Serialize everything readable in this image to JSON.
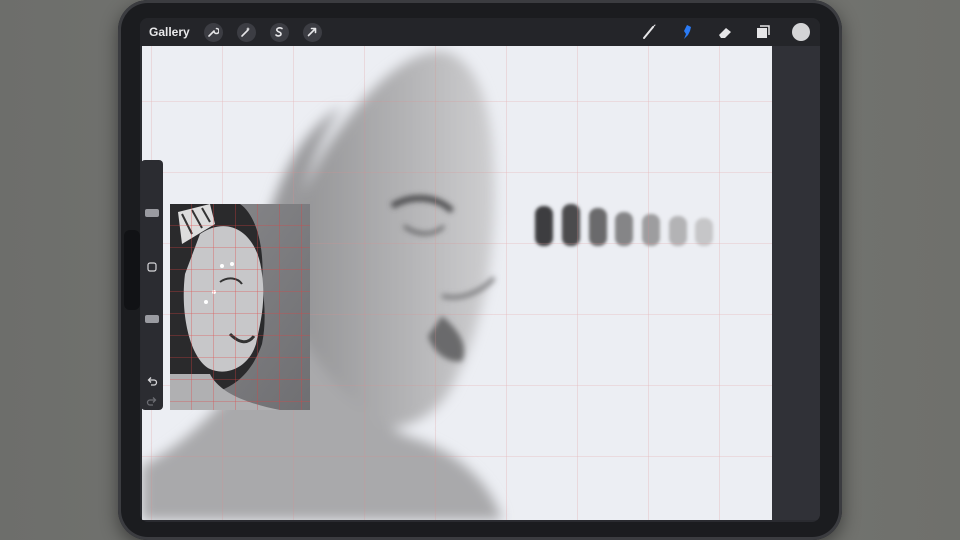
{
  "app": {
    "gallery_label": "Gallery"
  },
  "toolbar": {
    "left_tools": [
      {
        "name": "actions-icon"
      },
      {
        "name": "adjustments-icon"
      },
      {
        "name": "selection-icon"
      },
      {
        "name": "transform-icon"
      }
    ],
    "right_tools": [
      {
        "name": "brush-icon"
      },
      {
        "name": "smudge-icon"
      },
      {
        "name": "eraser-icon"
      },
      {
        "name": "layers-icon"
      },
      {
        "name": "color-swatch"
      }
    ]
  },
  "colors": {
    "accent": "#2a7bf6",
    "active_color": "#d4d4d6",
    "grid": "#e08a8a"
  },
  "sidebar": {
    "brush_size": 0.5,
    "brush_opacity": 0.6
  }
}
